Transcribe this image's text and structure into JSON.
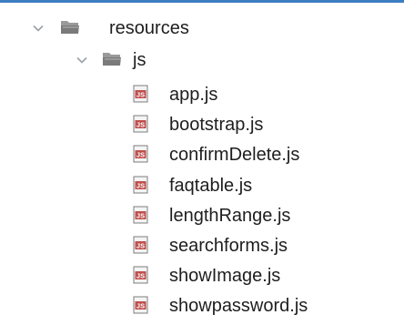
{
  "colors": {
    "top_accent": "#3d7ec1",
    "chevron": "#9aa0a6",
    "folder_body": "#8a8a8a",
    "folder_dark": "#5f5f5f",
    "js_file_border": "#7a7a7a",
    "js_file_fill": "#f5f5f5",
    "js_badge": "#c0504d",
    "text": "#1e1e1e"
  },
  "tree": {
    "resources": {
      "label": "resources",
      "icon": "folder-open-icon",
      "expanded": true
    },
    "js": {
      "label": "js",
      "icon": "folder-open-icon",
      "expanded": true
    },
    "files": [
      {
        "label": "app.js",
        "icon": "js-file-icon"
      },
      {
        "label": "bootstrap.js",
        "icon": "js-file-icon"
      },
      {
        "label": "confirmDelete.js",
        "icon": "js-file-icon"
      },
      {
        "label": "faqtable.js",
        "icon": "js-file-icon"
      },
      {
        "label": "lengthRange.js",
        "icon": "js-file-icon"
      },
      {
        "label": "searchforms.js",
        "icon": "js-file-icon"
      },
      {
        "label": "showImage.js",
        "icon": "js-file-icon"
      },
      {
        "label": "showpassword.js",
        "icon": "js-file-icon"
      }
    ]
  }
}
